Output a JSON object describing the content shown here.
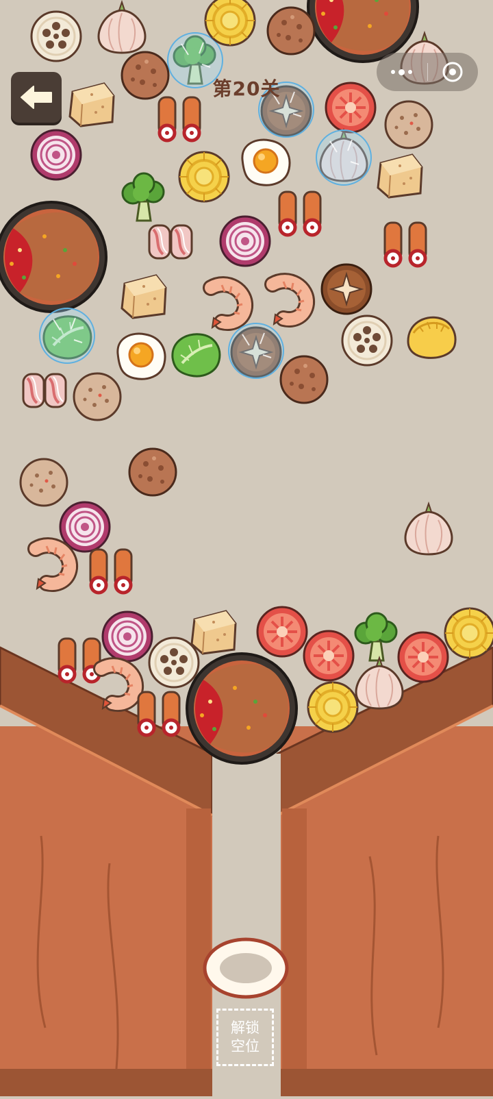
{
  "game": {
    "level_title": "第20关",
    "unlock_slot": {
      "line1": "解锁",
      "line2": "空位"
    }
  },
  "icons": {
    "back": "back-arrow-icon",
    "more": "more-dots-icon",
    "close": "mini-program-close-icon"
  },
  "colors": {
    "background": "#d2c9bb",
    "counter_wood": "#c9704a",
    "counter_edge": "#8e4a2c",
    "title": "#6b3e2c",
    "back_button": "#4a3d35"
  }
}
